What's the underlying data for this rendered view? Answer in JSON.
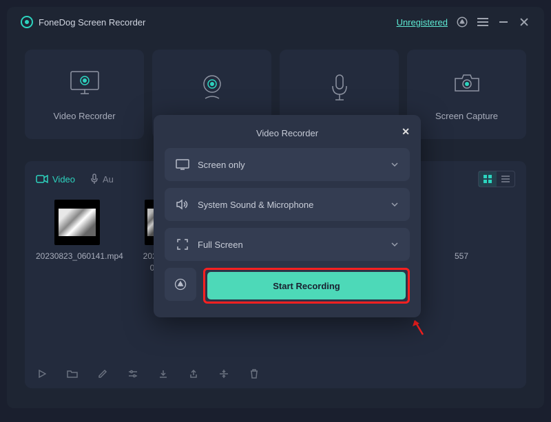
{
  "app": {
    "title": "FoneDog Screen Recorder",
    "status": "Unregistered"
  },
  "modes": [
    {
      "id": "video-recorder",
      "label": "Video Recorder"
    },
    {
      "id": "webcam-recorder",
      "label": ""
    },
    {
      "id": "audio-recorder",
      "label": ""
    },
    {
      "id": "screen-capture",
      "label": "Screen Capture"
    }
  ],
  "tabs": {
    "video": "Video",
    "audio": "Au"
  },
  "files": [
    {
      "name": "20230823_060141.mp4"
    },
    {
      "name": "2023\n0"
    },
    {
      "name": "557"
    }
  ],
  "modal": {
    "title": "Video Recorder",
    "row1": "Screen only",
    "row2": "System Sound & Microphone",
    "row3": "Full Screen",
    "start": "Start Recording"
  }
}
